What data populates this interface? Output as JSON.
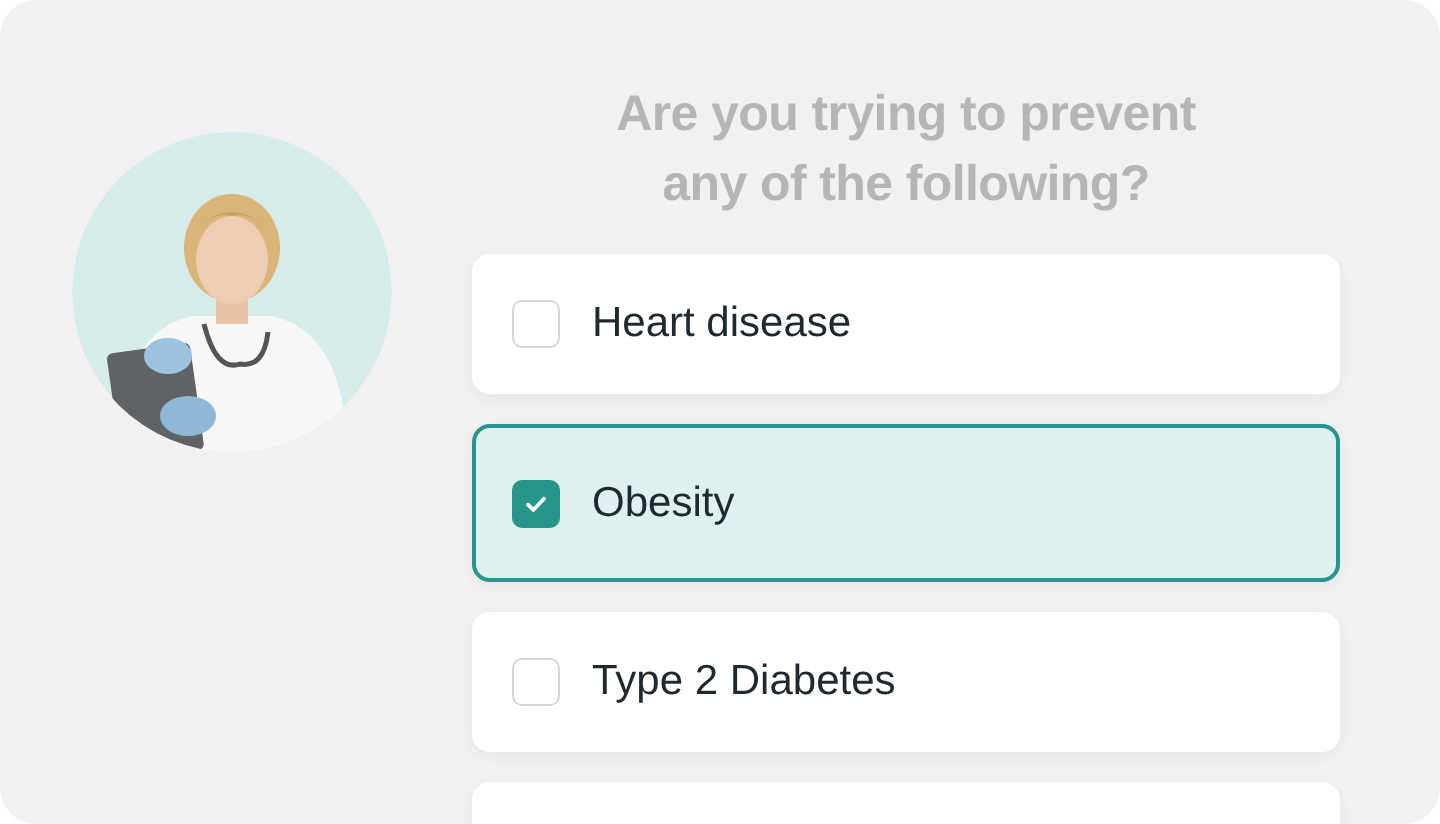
{
  "question": "Are you trying to prevent any of the following?",
  "options": [
    {
      "label": "Heart disease",
      "selected": false
    },
    {
      "label": "Obesity",
      "selected": true
    },
    {
      "label": "Type 2 Diabetes",
      "selected": false
    }
  ]
}
